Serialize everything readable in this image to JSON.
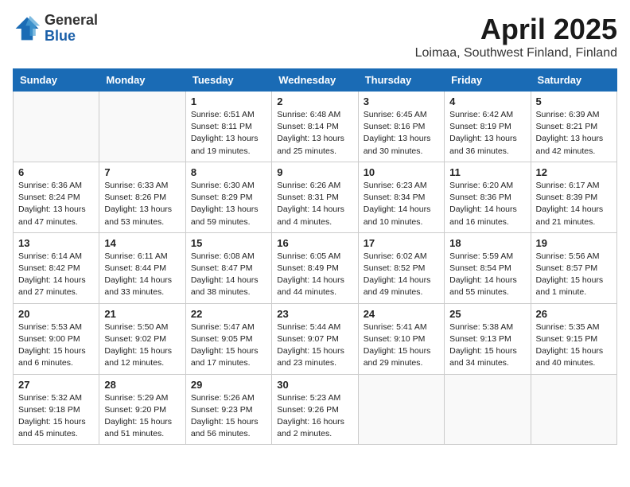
{
  "header": {
    "logo_general": "General",
    "logo_blue": "Blue",
    "title": "April 2025",
    "subtitle": "Loimaa, Southwest Finland, Finland"
  },
  "weekdays": [
    "Sunday",
    "Monday",
    "Tuesday",
    "Wednesday",
    "Thursday",
    "Friday",
    "Saturday"
  ],
  "weeks": [
    [
      {
        "day": "",
        "info": ""
      },
      {
        "day": "",
        "info": ""
      },
      {
        "day": "1",
        "info": "Sunrise: 6:51 AM\nSunset: 8:11 PM\nDaylight: 13 hours and 19 minutes."
      },
      {
        "day": "2",
        "info": "Sunrise: 6:48 AM\nSunset: 8:14 PM\nDaylight: 13 hours and 25 minutes."
      },
      {
        "day": "3",
        "info": "Sunrise: 6:45 AM\nSunset: 8:16 PM\nDaylight: 13 hours and 30 minutes."
      },
      {
        "day": "4",
        "info": "Sunrise: 6:42 AM\nSunset: 8:19 PM\nDaylight: 13 hours and 36 minutes."
      },
      {
        "day": "5",
        "info": "Sunrise: 6:39 AM\nSunset: 8:21 PM\nDaylight: 13 hours and 42 minutes."
      }
    ],
    [
      {
        "day": "6",
        "info": "Sunrise: 6:36 AM\nSunset: 8:24 PM\nDaylight: 13 hours and 47 minutes."
      },
      {
        "day": "7",
        "info": "Sunrise: 6:33 AM\nSunset: 8:26 PM\nDaylight: 13 hours and 53 minutes."
      },
      {
        "day": "8",
        "info": "Sunrise: 6:30 AM\nSunset: 8:29 PM\nDaylight: 13 hours and 59 minutes."
      },
      {
        "day": "9",
        "info": "Sunrise: 6:26 AM\nSunset: 8:31 PM\nDaylight: 14 hours and 4 minutes."
      },
      {
        "day": "10",
        "info": "Sunrise: 6:23 AM\nSunset: 8:34 PM\nDaylight: 14 hours and 10 minutes."
      },
      {
        "day": "11",
        "info": "Sunrise: 6:20 AM\nSunset: 8:36 PM\nDaylight: 14 hours and 16 minutes."
      },
      {
        "day": "12",
        "info": "Sunrise: 6:17 AM\nSunset: 8:39 PM\nDaylight: 14 hours and 21 minutes."
      }
    ],
    [
      {
        "day": "13",
        "info": "Sunrise: 6:14 AM\nSunset: 8:42 PM\nDaylight: 14 hours and 27 minutes."
      },
      {
        "day": "14",
        "info": "Sunrise: 6:11 AM\nSunset: 8:44 PM\nDaylight: 14 hours and 33 minutes."
      },
      {
        "day": "15",
        "info": "Sunrise: 6:08 AM\nSunset: 8:47 PM\nDaylight: 14 hours and 38 minutes."
      },
      {
        "day": "16",
        "info": "Sunrise: 6:05 AM\nSunset: 8:49 PM\nDaylight: 14 hours and 44 minutes."
      },
      {
        "day": "17",
        "info": "Sunrise: 6:02 AM\nSunset: 8:52 PM\nDaylight: 14 hours and 49 minutes."
      },
      {
        "day": "18",
        "info": "Sunrise: 5:59 AM\nSunset: 8:54 PM\nDaylight: 14 hours and 55 minutes."
      },
      {
        "day": "19",
        "info": "Sunrise: 5:56 AM\nSunset: 8:57 PM\nDaylight: 15 hours and 1 minute."
      }
    ],
    [
      {
        "day": "20",
        "info": "Sunrise: 5:53 AM\nSunset: 9:00 PM\nDaylight: 15 hours and 6 minutes."
      },
      {
        "day": "21",
        "info": "Sunrise: 5:50 AM\nSunset: 9:02 PM\nDaylight: 15 hours and 12 minutes."
      },
      {
        "day": "22",
        "info": "Sunrise: 5:47 AM\nSunset: 9:05 PM\nDaylight: 15 hours and 17 minutes."
      },
      {
        "day": "23",
        "info": "Sunrise: 5:44 AM\nSunset: 9:07 PM\nDaylight: 15 hours and 23 minutes."
      },
      {
        "day": "24",
        "info": "Sunrise: 5:41 AM\nSunset: 9:10 PM\nDaylight: 15 hours and 29 minutes."
      },
      {
        "day": "25",
        "info": "Sunrise: 5:38 AM\nSunset: 9:13 PM\nDaylight: 15 hours and 34 minutes."
      },
      {
        "day": "26",
        "info": "Sunrise: 5:35 AM\nSunset: 9:15 PM\nDaylight: 15 hours and 40 minutes."
      }
    ],
    [
      {
        "day": "27",
        "info": "Sunrise: 5:32 AM\nSunset: 9:18 PM\nDaylight: 15 hours and 45 minutes."
      },
      {
        "day": "28",
        "info": "Sunrise: 5:29 AM\nSunset: 9:20 PM\nDaylight: 15 hours and 51 minutes."
      },
      {
        "day": "29",
        "info": "Sunrise: 5:26 AM\nSunset: 9:23 PM\nDaylight: 15 hours and 56 minutes."
      },
      {
        "day": "30",
        "info": "Sunrise: 5:23 AM\nSunset: 9:26 PM\nDaylight: 16 hours and 2 minutes."
      },
      {
        "day": "",
        "info": ""
      },
      {
        "day": "",
        "info": ""
      },
      {
        "day": "",
        "info": ""
      }
    ]
  ]
}
